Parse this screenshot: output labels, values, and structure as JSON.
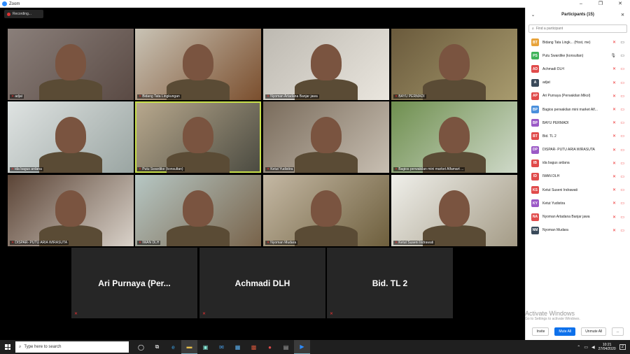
{
  "window": {
    "title": "Zoom",
    "minimize": "–",
    "maximize": "❐",
    "close": "✕"
  },
  "recording": {
    "label": "Recording..."
  },
  "video_tiles": [
    {
      "name": "adjat",
      "colors": [
        "#8a7f7a",
        "#5a4a44"
      ]
    },
    {
      "name": "Bidang Tata Lingkungan",
      "colors": [
        "#c9c3b5",
        "#7b4f2e"
      ]
    },
    {
      "name": "Nyoman Artadana Banjar jawa",
      "colors": [
        "#bdb9b1",
        "#eae6de"
      ]
    },
    {
      "name": "BAYU PERMADI",
      "colors": [
        "#6a5a3c",
        "#a89b6e"
      ]
    },
    {
      "name": "ida bagus ardana",
      "colors": [
        "#dfe3e2",
        "#9aa5a2"
      ]
    },
    {
      "name": "Putu Swardike (konsultan)",
      "colors": [
        "#b9a98e",
        "#4a4a40"
      ]
    },
    {
      "name": "Ketut Yudistira",
      "colors": [
        "#7a6c5c",
        "#c8bfb2"
      ]
    },
    {
      "name": "Bagios perwakilan mini market Alfamart ...",
      "colors": [
        "#6f8f4f",
        "#cfd9c9"
      ]
    },
    {
      "name": "DISPAR- PUTU ARIA WIRASUTA",
      "colors": [
        "#5b4436",
        "#d9d2c9"
      ]
    },
    {
      "name": "IWAN DLH",
      "colors": [
        "#b6c7c4",
        "#78634a"
      ]
    },
    {
      "name": "Nyoman Mudara",
      "colors": [
        "#c4b8a4",
        "#6e5f3d"
      ]
    },
    {
      "name": "Ketut Suseni Indrawati",
      "colors": [
        "#efefea",
        "#a49b86"
      ]
    }
  ],
  "name_tiles": [
    {
      "name": "Ari  Purnaya  (Per..."
    },
    {
      "name": "Achmadi DLH"
    },
    {
      "name": "Bid. TL 2"
    }
  ],
  "panel": {
    "title": "Participants (15)",
    "search_placeholder": "Find a participant",
    "participants": [
      {
        "initials": "BT",
        "name": "Bidang Tata Lingk... (Host, me)",
        "color": "#e8a33a"
      },
      {
        "initials": "PS",
        "name": "Putu Swardike (konsultan)",
        "color": "#3fb35a"
      },
      {
        "initials": "AD",
        "name": "Achmadi DLH",
        "color": "#e04b4b"
      },
      {
        "initials": "A",
        "name": "adjat",
        "color": "#3a4a5a"
      },
      {
        "initials": "AP",
        "name": "Ari Purnaya (Perwakilan Mikol)",
        "color": "#e04b4b"
      },
      {
        "initials": "BP",
        "name": "Bagios perwakilan mini market Alf...",
        "color": "#4a8fdc"
      },
      {
        "initials": "BP",
        "name": "BAYU PERMADI",
        "color": "#9b59c6"
      },
      {
        "initials": "BT",
        "name": "Bid. TL 2",
        "color": "#e04b4b"
      },
      {
        "initials": "DP",
        "name": "DISPAR- PUTU ARIA WIRASUTA",
        "color": "#9b59c6"
      },
      {
        "initials": "IB",
        "name": "ida bagus ardana",
        "color": "#e04b4b"
      },
      {
        "initials": "ID",
        "name": "IWAN DLH",
        "color": "#e04b4b"
      },
      {
        "initials": "KS",
        "name": "Ketut Suseni Indrawati",
        "color": "#e04b4b"
      },
      {
        "initials": "KY",
        "name": "Ketut Yudistira",
        "color": "#9b59c6"
      },
      {
        "initials": "NA",
        "name": "Nyoman Artadana Banjar jawa",
        "color": "#e04b4b"
      },
      {
        "initials": "NM",
        "name": "Nyoman Mudara",
        "color": "#3a4a5a"
      }
    ],
    "buttons": {
      "invite": "Invite",
      "mute_all": "Mute All",
      "unmute_all": "Unmute All",
      "more": "..."
    }
  },
  "watermark": {
    "line1": "Activate Windows",
    "line2": "Go to Settings to activate Windows."
  },
  "taskbar": {
    "search_placeholder": "Type here to search",
    "time": "10:21",
    "date": "27/04/2020",
    "notifications": "2"
  }
}
